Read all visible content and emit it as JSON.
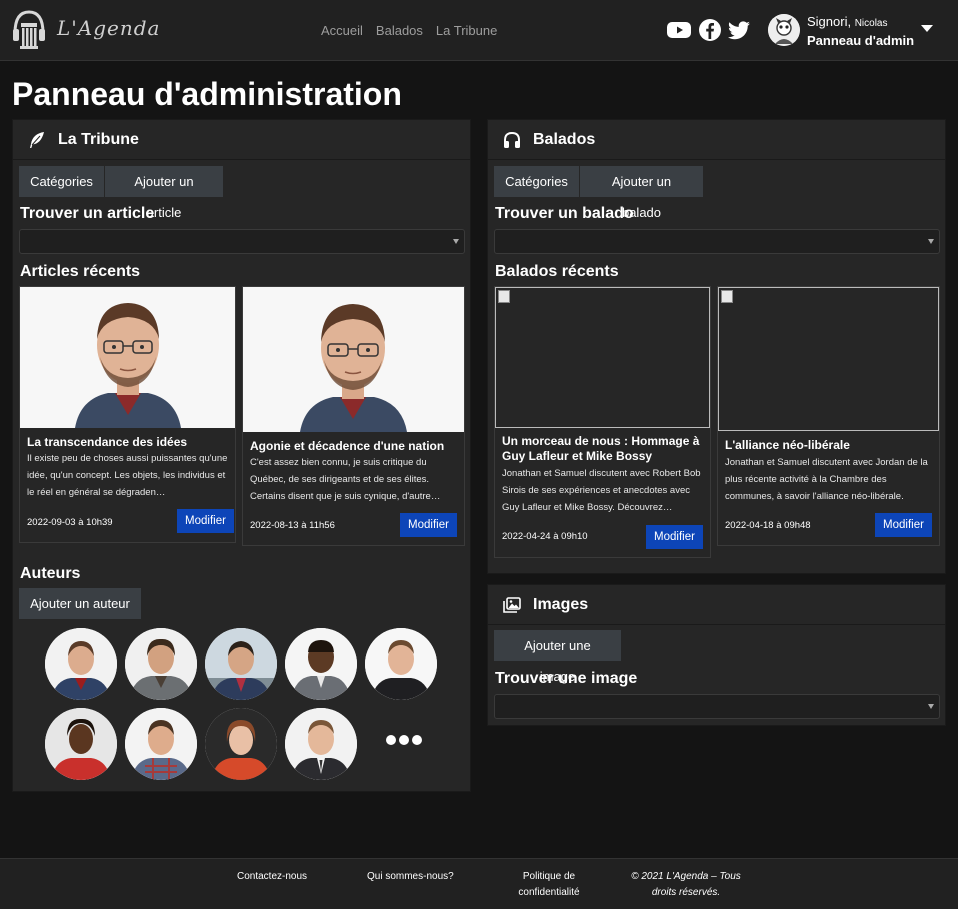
{
  "header": {
    "logo_text": "L'Agenda",
    "nav": [
      "Accueil",
      "Balados",
      "La Tribune"
    ],
    "social": [
      "youtube-icon",
      "facebook-icon",
      "twitter-icon"
    ],
    "user_last": "Signori,",
    "user_first": "Nicolas",
    "user_link": "Panneau d'admin"
  },
  "page_title": "Panneau d'administration",
  "tribune": {
    "title": "La Tribune",
    "btn_categories": "Catégories",
    "btn_add": "Ajouter un article",
    "find_label": "Trouver un article",
    "recent_label": "Articles récents",
    "articles": [
      {
        "title": "La transcendance des idées",
        "excerpt": "Il existe peu de choses aussi puissantes qu'une idée, qu'un concept. Les objets, les individus et le réel en général se dégraden…",
        "date": "2022-09-03 à 10h39",
        "action": "Modifier"
      },
      {
        "title": "Agonie et décadence d'une nation",
        "excerpt": "C'est assez bien connu, je suis critique du Québec, de ses dirigeants et de ses élites. Certains disent que je suis cynique, d'autre…",
        "date": "2022-08-13 à 11h56",
        "action": "Modifier"
      }
    ],
    "authors_label": "Auteurs",
    "btn_add_author": "Ajouter un auteur"
  },
  "balados": {
    "title": "Balados",
    "btn_categories": "Catégories",
    "btn_add": "Ajouter un balado",
    "find_label": "Trouver un balado",
    "recent_label": "Balados récents",
    "items": [
      {
        "title": "Un morceau de nous : Hommage à Guy Lafleur et Mike Bossy",
        "excerpt": "Jonathan et Samuel discutent avec Robert Bob Sirois de ses expériences et anecdotes avec Guy Lafleur et Mike Bossy. Découvrez…",
        "date": "2022-04-24 à 09h10",
        "action": "Modifier"
      },
      {
        "title": "L'alliance néo-libérale",
        "excerpt": "Jonathan et Samuel discutent avec Jordan de la plus récente activité à la Chambre des communes, à savoir l'alliance néo-libérale.",
        "date": "2022-04-18 à 09h48",
        "action": "Modifier"
      }
    ]
  },
  "images": {
    "title": "Images",
    "btn_add": "Ajouter une image",
    "find_label": "Trouver une image"
  },
  "footer": {
    "contact": "Contactez-nous",
    "about": "Qui sommes-nous?",
    "privacy_1": "Politique de",
    "privacy_2": "confidentialité",
    "copyright_1": "© 2021 L'Agenda – Tous",
    "copyright_2": "droits réservés."
  },
  "colors": {
    "background": "#141414",
    "panel": "#262626",
    "header": "#212121",
    "primary_button": "#0d45b8",
    "secondary_button": "#3a3f44"
  }
}
